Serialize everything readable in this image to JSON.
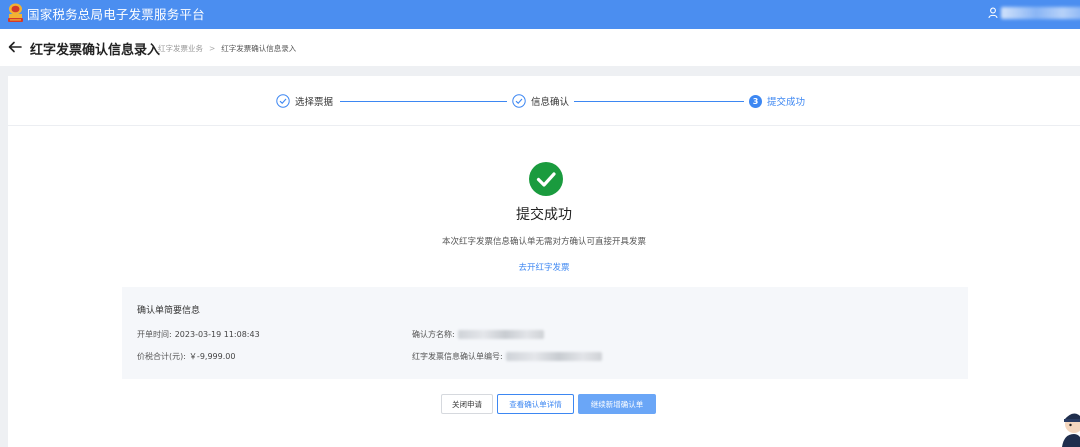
{
  "topbar": {
    "app_title": "国家税务总局电子发票服务平台",
    "logo_icon": "tax-emblem-icon",
    "user_icon": "user-icon"
  },
  "header": {
    "back_icon": "arrow-left-icon",
    "page_title": "红字发票确认信息录入",
    "breadcrumb": [
      "红字发票业务",
      "红字发票确认信息录入"
    ],
    "breadcrumb_separator": ">"
  },
  "steps": [
    {
      "label": "选择票据",
      "state": "done",
      "icon": "check-circle-icon"
    },
    {
      "label": "信息确认",
      "state": "done",
      "icon": "check-circle-icon"
    },
    {
      "number": "3",
      "label": "提交成功",
      "state": "active"
    }
  ],
  "result": {
    "icon": "success-check-icon",
    "title": "提交成功",
    "description": "本次红字发票信息确认单无需对方确认可直接开具发票",
    "link_label": "去开红字发票"
  },
  "summary": {
    "title": "确认单简要信息",
    "issue_time_label": "开单时间:",
    "issue_time_value": "2023-03-19 11:08:43",
    "total_label": "价税合计(元):",
    "total_value": "￥-9,999.00",
    "confirmer_label": "确认方名称:",
    "form_no_label": "红字发票信息确认单编号:"
  },
  "buttons": {
    "close": "关闭申请",
    "view": "查看确认单详情",
    "new": "继续新增确认单"
  },
  "colors": {
    "topbar": "#4b8ef0",
    "primary": "#3d87f2",
    "success": "#1a9b3e",
    "primary_light": "#6aa6f7"
  }
}
